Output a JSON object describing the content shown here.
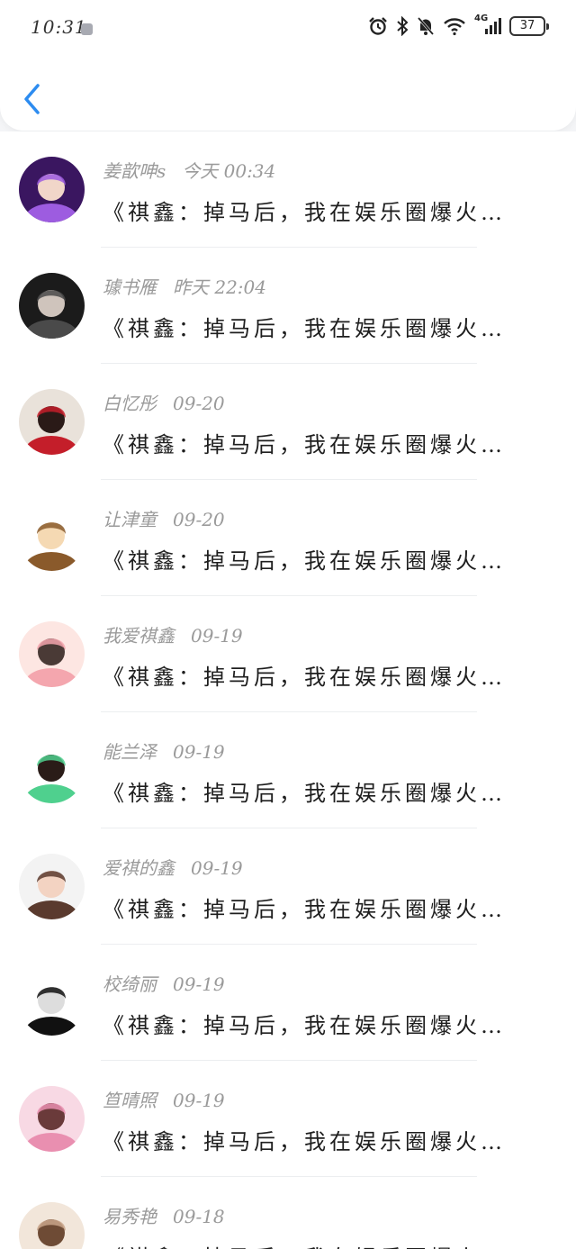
{
  "status_bar": {
    "time": "10:31",
    "network": "4G",
    "battery": "37",
    "icons": [
      "alarm-icon",
      "bluetooth-icon",
      "mute-bell-icon",
      "wifi-icon",
      "signal-icon",
      "battery-icon"
    ]
  },
  "header": {
    "back_icon": "chevron-left-icon",
    "accent_color": "#2d8cf0"
  },
  "messages": [
    {
      "name": "姜歆呻s",
      "time": "今天 00:34",
      "preview": "《祺鑫：掉马后，我在娱乐圈爆火…",
      "avatar_colors": [
        "#3a1660",
        "#9d5ce0",
        "#f1d6c9"
      ]
    },
    {
      "name": "璩书雁",
      "time": "昨天 22:04",
      "preview": "《祺鑫：掉马后，我在娱乐圈爆火…",
      "avatar_colors": [
        "#1b1b1b",
        "#4a4a4a",
        "#cfc4bc"
      ]
    },
    {
      "name": "白忆彤",
      "time": "09-20",
      "preview": "《祺鑫：掉马后，我在娱乐圈爆火…",
      "avatar_colors": [
        "#e9e2da",
        "#c41e2a",
        "#2a1a17"
      ]
    },
    {
      "name": "让津童",
      "time": "09-20",
      "preview": "《祺鑫：掉马后，我在娱乐圈爆火…",
      "avatar_colors": [
        "#ffffff",
        "#8a5a2b",
        "#f5d9b3"
      ]
    },
    {
      "name": "我爱祺鑫",
      "time": "09-19",
      "preview": "《祺鑫：掉马后，我在娱乐圈爆火…",
      "avatar_colors": [
        "#fde6e2",
        "#f4a6ae",
        "#4a3a36"
      ]
    },
    {
      "name": "能兰泽",
      "time": "09-19",
      "preview": "《祺鑫：掉马后，我在娱乐圈爆火…",
      "avatar_colors": [
        "#ffffff",
        "#4fd08e",
        "#2a1c18"
      ]
    },
    {
      "name": "爱祺的鑫",
      "time": "09-19",
      "preview": "《祺鑫：掉马后，我在娱乐圈爆火…",
      "avatar_colors": [
        "#f3f3f3",
        "#5a3a2e",
        "#f3d3c2"
      ]
    },
    {
      "name": "校绮丽",
      "time": "09-19",
      "preview": "《祺鑫：掉马后，我在娱乐圈爆火…",
      "avatar_colors": [
        "#ffffff",
        "#111111",
        "#dddddd"
      ]
    },
    {
      "name": "笪晴照",
      "time": "09-19",
      "preview": "《祺鑫：掉马后，我在娱乐圈爆火…",
      "avatar_colors": [
        "#f8d9e4",
        "#e98fb0",
        "#6a3a3a"
      ]
    },
    {
      "name": "易秀艳",
      "time": "09-18",
      "preview": "《祺鑫：掉马后，我在娱乐圈爆火…",
      "avatar_colors": [
        "#f2e6da",
        "#c9a58a",
        "#6e4b35"
      ]
    }
  ]
}
